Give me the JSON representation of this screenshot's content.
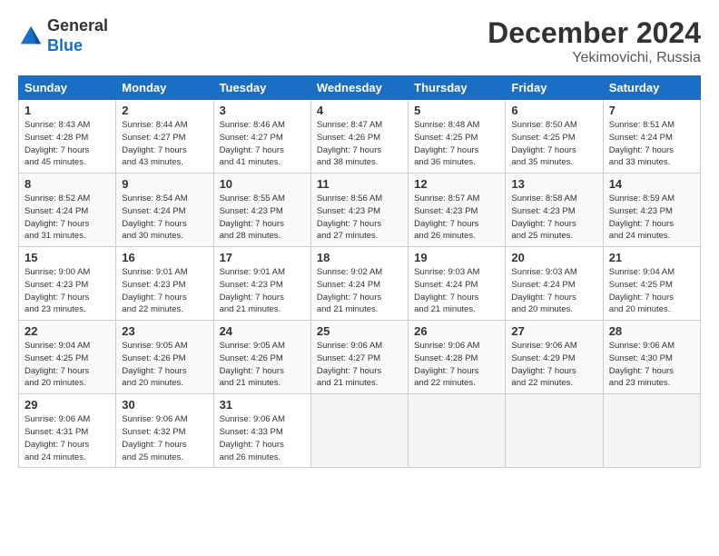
{
  "header": {
    "logo_line1": "General",
    "logo_line2": "Blue",
    "month": "December 2024",
    "location": "Yekimovichi, Russia"
  },
  "weekdays": [
    "Sunday",
    "Monday",
    "Tuesday",
    "Wednesday",
    "Thursday",
    "Friday",
    "Saturday"
  ],
  "weeks": [
    [
      {
        "day": "1",
        "info": "Sunrise: 8:43 AM\nSunset: 4:28 PM\nDaylight: 7 hours\nand 45 minutes."
      },
      {
        "day": "2",
        "info": "Sunrise: 8:44 AM\nSunset: 4:27 PM\nDaylight: 7 hours\nand 43 minutes."
      },
      {
        "day": "3",
        "info": "Sunrise: 8:46 AM\nSunset: 4:27 PM\nDaylight: 7 hours\nand 41 minutes."
      },
      {
        "day": "4",
        "info": "Sunrise: 8:47 AM\nSunset: 4:26 PM\nDaylight: 7 hours\nand 38 minutes."
      },
      {
        "day": "5",
        "info": "Sunrise: 8:48 AM\nSunset: 4:25 PM\nDaylight: 7 hours\nand 36 minutes."
      },
      {
        "day": "6",
        "info": "Sunrise: 8:50 AM\nSunset: 4:25 PM\nDaylight: 7 hours\nand 35 minutes."
      },
      {
        "day": "7",
        "info": "Sunrise: 8:51 AM\nSunset: 4:24 PM\nDaylight: 7 hours\nand 33 minutes."
      }
    ],
    [
      {
        "day": "8",
        "info": "Sunrise: 8:52 AM\nSunset: 4:24 PM\nDaylight: 7 hours\nand 31 minutes."
      },
      {
        "day": "9",
        "info": "Sunrise: 8:54 AM\nSunset: 4:24 PM\nDaylight: 7 hours\nand 30 minutes."
      },
      {
        "day": "10",
        "info": "Sunrise: 8:55 AM\nSunset: 4:23 PM\nDaylight: 7 hours\nand 28 minutes."
      },
      {
        "day": "11",
        "info": "Sunrise: 8:56 AM\nSunset: 4:23 PM\nDaylight: 7 hours\nand 27 minutes."
      },
      {
        "day": "12",
        "info": "Sunrise: 8:57 AM\nSunset: 4:23 PM\nDaylight: 7 hours\nand 26 minutes."
      },
      {
        "day": "13",
        "info": "Sunrise: 8:58 AM\nSunset: 4:23 PM\nDaylight: 7 hours\nand 25 minutes."
      },
      {
        "day": "14",
        "info": "Sunrise: 8:59 AM\nSunset: 4:23 PM\nDaylight: 7 hours\nand 24 minutes."
      }
    ],
    [
      {
        "day": "15",
        "info": "Sunrise: 9:00 AM\nSunset: 4:23 PM\nDaylight: 7 hours\nand 23 minutes."
      },
      {
        "day": "16",
        "info": "Sunrise: 9:01 AM\nSunset: 4:23 PM\nDaylight: 7 hours\nand 22 minutes."
      },
      {
        "day": "17",
        "info": "Sunrise: 9:01 AM\nSunset: 4:23 PM\nDaylight: 7 hours\nand 21 minutes."
      },
      {
        "day": "18",
        "info": "Sunrise: 9:02 AM\nSunset: 4:24 PM\nDaylight: 7 hours\nand 21 minutes."
      },
      {
        "day": "19",
        "info": "Sunrise: 9:03 AM\nSunset: 4:24 PM\nDaylight: 7 hours\nand 21 minutes."
      },
      {
        "day": "20",
        "info": "Sunrise: 9:03 AM\nSunset: 4:24 PM\nDaylight: 7 hours\nand 20 minutes."
      },
      {
        "day": "21",
        "info": "Sunrise: 9:04 AM\nSunset: 4:25 PM\nDaylight: 7 hours\nand 20 minutes."
      }
    ],
    [
      {
        "day": "22",
        "info": "Sunrise: 9:04 AM\nSunset: 4:25 PM\nDaylight: 7 hours\nand 20 minutes."
      },
      {
        "day": "23",
        "info": "Sunrise: 9:05 AM\nSunset: 4:26 PM\nDaylight: 7 hours\nand 20 minutes."
      },
      {
        "day": "24",
        "info": "Sunrise: 9:05 AM\nSunset: 4:26 PM\nDaylight: 7 hours\nand 21 minutes."
      },
      {
        "day": "25",
        "info": "Sunrise: 9:06 AM\nSunset: 4:27 PM\nDaylight: 7 hours\nand 21 minutes."
      },
      {
        "day": "26",
        "info": "Sunrise: 9:06 AM\nSunset: 4:28 PM\nDaylight: 7 hours\nand 22 minutes."
      },
      {
        "day": "27",
        "info": "Sunrise: 9:06 AM\nSunset: 4:29 PM\nDaylight: 7 hours\nand 22 minutes."
      },
      {
        "day": "28",
        "info": "Sunrise: 9:06 AM\nSunset: 4:30 PM\nDaylight: 7 hours\nand 23 minutes."
      }
    ],
    [
      {
        "day": "29",
        "info": "Sunrise: 9:06 AM\nSunset: 4:31 PM\nDaylight: 7 hours\nand 24 minutes."
      },
      {
        "day": "30",
        "info": "Sunrise: 9:06 AM\nSunset: 4:32 PM\nDaylight: 7 hours\nand 25 minutes."
      },
      {
        "day": "31",
        "info": "Sunrise: 9:06 AM\nSunset: 4:33 PM\nDaylight: 7 hours\nand 26 minutes."
      },
      {
        "day": "",
        "info": ""
      },
      {
        "day": "",
        "info": ""
      },
      {
        "day": "",
        "info": ""
      },
      {
        "day": "",
        "info": ""
      }
    ]
  ]
}
